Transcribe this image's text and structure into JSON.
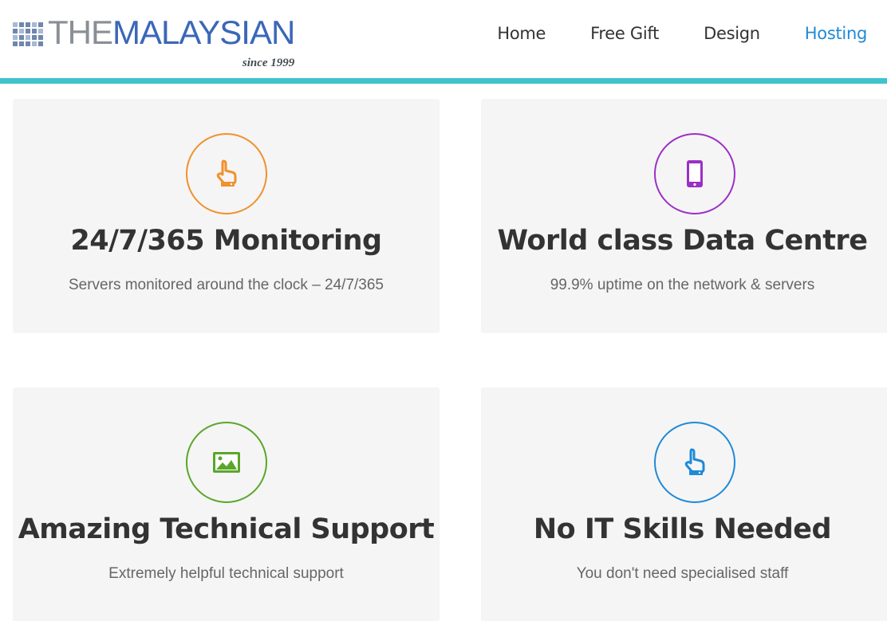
{
  "header": {
    "logo": {
      "prefix": "THE",
      "name": "MALAYSIAN",
      "tagline": "since 1999"
    },
    "nav": [
      {
        "label": "Home",
        "active": false
      },
      {
        "label": "Free Gift",
        "active": false
      },
      {
        "label": "Design",
        "active": false
      },
      {
        "label": "Hosting",
        "active": true
      }
    ],
    "accent_color": "#3ec4cc",
    "active_nav_color": "#1f8ad6"
  },
  "features": [
    {
      "title": "24/7/365 Monitoring",
      "description": "Servers monitored around the clock – 24/7/365",
      "icon": "pointing-hand-icon",
      "color": "#f0912d"
    },
    {
      "title": "World class Data Centre",
      "description": "99.9% uptime on the network & servers",
      "icon": "mobile-phone-icon",
      "color": "#9b30c6"
    },
    {
      "title": "Amazing Technical Support",
      "description": "Extremely helpful technical support",
      "icon": "image-icon",
      "color": "#5aa62a"
    },
    {
      "title": "No IT Skills Needed",
      "description": "You don't need specialised staff",
      "icon": "pointing-hand-icon",
      "color": "#1e8ad8"
    }
  ]
}
